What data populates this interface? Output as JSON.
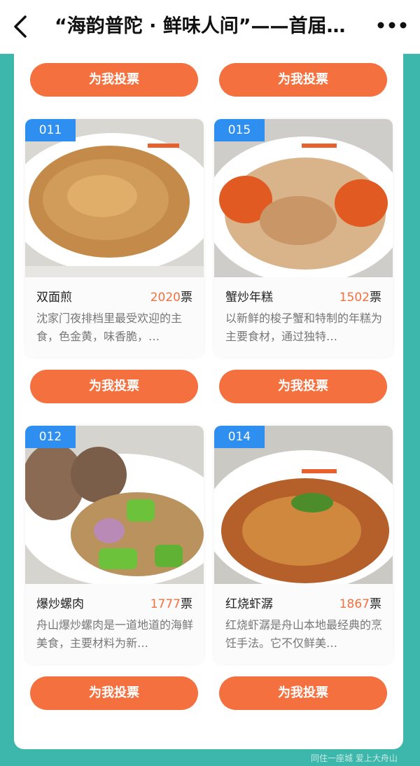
{
  "header": {
    "title": "“海韵普陀 · 鲜味人间”——首届…"
  },
  "vote_label": "为我投票",
  "vote_unit": "票",
  "cards": [
    {
      "number": "011",
      "name": "双面煎",
      "votes": "2020",
      "desc": "沈家门夜排档里最受欢迎的主食，色金黄，味香脆，…"
    },
    {
      "number": "015",
      "name": "蟹炒年糕",
      "votes": "1502",
      "desc": "以新鲜的梭子蟹和特制的年糕为主要食材，通过独特…"
    },
    {
      "number": "012",
      "name": "爆炒螺肉",
      "votes": "1777",
      "desc": "舟山爆炒螺肉是一道地道的海鲜美食，主要材料为新…"
    },
    {
      "number": "014",
      "name": "红烧虾潺",
      "votes": "1867",
      "desc": "红烧虾潺是舟山本地最经典的烹饪手法。它不仅鲜美…"
    }
  ],
  "watermark": "同住一座城 爱上大舟山",
  "colors": {
    "teal_bg": "#3db6ac",
    "vote_orange": "#f5703f",
    "badge_blue": "#2f8ff0"
  }
}
